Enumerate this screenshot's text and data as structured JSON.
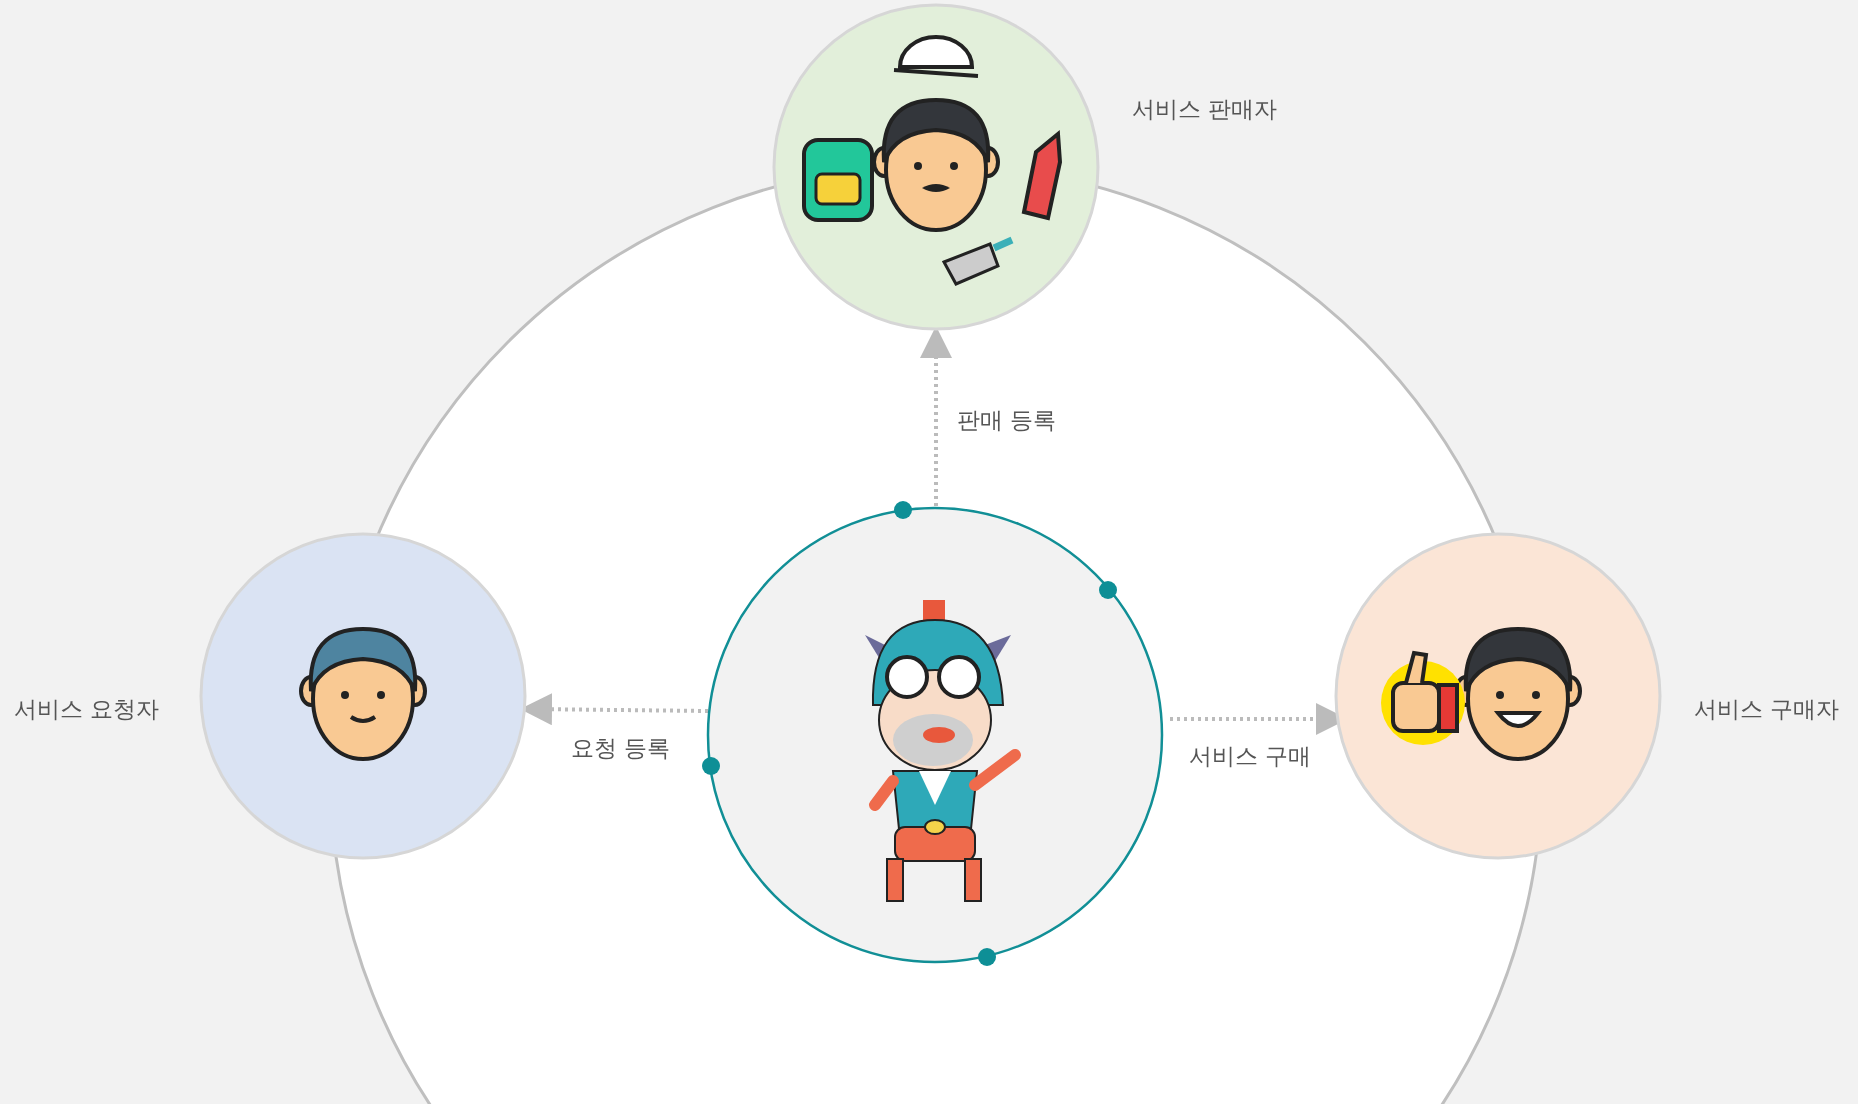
{
  "actors": [
    {
      "kind": "seller",
      "label": "서비스 판매자",
      "color": "#e2efda"
    },
    {
      "kind": "requester",
      "label": "서비스 요청자",
      "color": "#dae3f3"
    },
    {
      "kind": "buyer",
      "label": "서비스 구매자",
      "color": "#fbe5d6"
    }
  ],
  "flows": [
    {
      "kind": "up",
      "label": "판매 등록"
    },
    {
      "kind": "left",
      "label": "요청 등록"
    },
    {
      "kind": "right",
      "label": "서비스 구매"
    }
  ]
}
